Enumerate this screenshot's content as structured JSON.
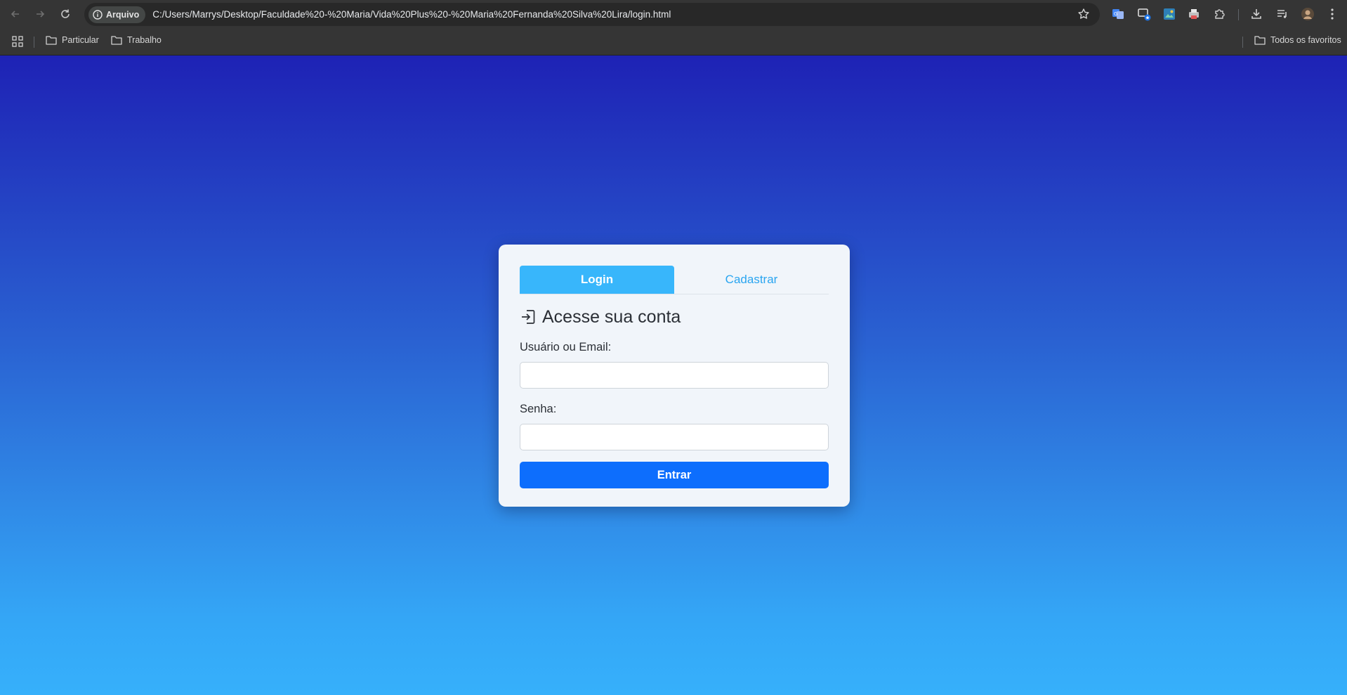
{
  "browser": {
    "address_chip": "Arquivo",
    "url": "C:/Users/Marrys/Desktop/Faculdade%20-%20Maria/Vida%20Plus%20-%20Maria%20Fernanda%20Silva%20Lira/login.html"
  },
  "bookmarks": {
    "items": [
      {
        "label": "Particular",
        "icon": "folder-icon"
      },
      {
        "label": "Trabalho",
        "icon": "folder-icon"
      }
    ],
    "all_bookmarks": "Todos os favoritos"
  },
  "auth": {
    "tabs": [
      {
        "label": "Login",
        "active": true
      },
      {
        "label": "Cadastrar",
        "active": false
      }
    ],
    "heading": "Acesse sua conta",
    "heading_icon": "login-icon",
    "user_label": "Usuário ou Email:",
    "user_value": "",
    "password_label": "Senha:",
    "password_value": "",
    "submit_label": "Entrar"
  },
  "colors": {
    "gradient_top": "#1e22b5",
    "gradient_bottom": "#36b0fb",
    "tab_active": "#38b6fb",
    "button_primary": "#0d6efd"
  }
}
